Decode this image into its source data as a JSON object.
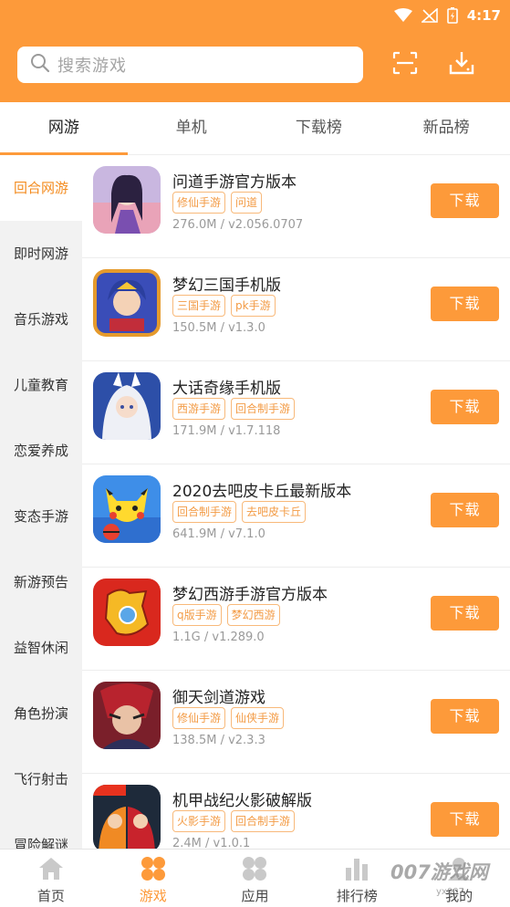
{
  "status_bar": {
    "time": "4:17"
  },
  "search": {
    "placeholder": "搜索游戏"
  },
  "tabs": [
    {
      "label": "网游",
      "active": true
    },
    {
      "label": "单机",
      "active": false
    },
    {
      "label": "下载榜",
      "active": false
    },
    {
      "label": "新品榜",
      "active": false
    }
  ],
  "sidebar": {
    "items": [
      {
        "label": "回合网游",
        "active": true
      },
      {
        "label": "即时网游"
      },
      {
        "label": "音乐游戏"
      },
      {
        "label": "儿童教育"
      },
      {
        "label": "恋爱养成"
      },
      {
        "label": "变态手游"
      },
      {
        "label": "新游预告"
      },
      {
        "label": "益智休闲"
      },
      {
        "label": "角色扮演"
      },
      {
        "label": "飞行射击"
      },
      {
        "label": "冒险解谜"
      }
    ]
  },
  "games": [
    {
      "name": "问道手游官方版本",
      "tags": [
        "修仙手游",
        "问道"
      ],
      "meta": "276.0M / v2.056.0707",
      "button": "下载"
    },
    {
      "name": "梦幻三国手机版",
      "tags": [
        "三国手游",
        "pk手游"
      ],
      "meta": "150.5M / v1.3.0",
      "button": "下载"
    },
    {
      "name": "大话奇缘手机版",
      "tags": [
        "西游手游",
        "回合制手游"
      ],
      "meta": "171.9M / v1.7.118",
      "button": "下载"
    },
    {
      "name": "2020去吧皮卡丘最新版本",
      "tags": [
        "回合制手游",
        "去吧皮卡丘"
      ],
      "meta": "641.9M / v7.1.0",
      "button": "下载"
    },
    {
      "name": "梦幻西游手游官方版本",
      "tags": [
        "q版手游",
        "梦幻西游"
      ],
      "meta": "1.1G / v1.289.0",
      "button": "下载"
    },
    {
      "name": "御天剑道游戏",
      "tags": [
        "修仙手游",
        "仙侠手游"
      ],
      "meta": "138.5M / v2.3.3",
      "button": "下载"
    },
    {
      "name": "机甲战纪火影破解版",
      "tags": [
        "火影手游",
        "回合制手游"
      ],
      "meta": "2.4M / v1.0.1",
      "button": "下载"
    }
  ],
  "bottom_nav": [
    {
      "label": "首页",
      "icon": "home-icon"
    },
    {
      "label": "游戏",
      "icon": "game-icon",
      "active": true
    },
    {
      "label": "应用",
      "icon": "apps-icon"
    },
    {
      "label": "排行榜",
      "icon": "rank-icon"
    },
    {
      "label": "我的",
      "icon": "user-icon"
    }
  ],
  "watermark": {
    "text": "007游戏网",
    "sub": "yx007"
  },
  "colors": {
    "accent": "#fd9a3a",
    "tag_border": "#f8b97a",
    "sidebar_bg": "#f2f2f2"
  }
}
